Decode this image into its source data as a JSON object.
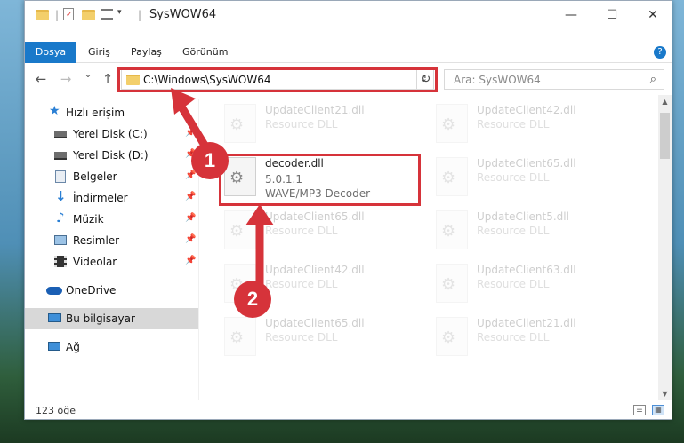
{
  "window": {
    "title": "SysWOW64",
    "controls": {
      "minimize": "—",
      "maximize": "☐",
      "close": "✕"
    }
  },
  "ribbon": {
    "tabs": [
      "Dosya",
      "Giriş",
      "Paylaş",
      "Görünüm"
    ],
    "help": "?"
  },
  "nav": {
    "back": "←",
    "forward": "→",
    "recent": "⌄",
    "up": "↑",
    "address": "C:\\Windows\\SysWOW64",
    "address_chevron": "⌄",
    "refresh": "↻",
    "search_placeholder": "Ara: SysWOW64",
    "search_icon": "⌕"
  },
  "sidebar": {
    "items": [
      {
        "label": "Hızlı erişim",
        "icon": "star-icon",
        "pinned": false
      },
      {
        "label": "Yerel Disk (C:)",
        "icon": "drive-icon",
        "pinned": true
      },
      {
        "label": "Yerel Disk (D:)",
        "icon": "drive-icon",
        "pinned": true
      },
      {
        "label": "Belgeler",
        "icon": "documents-icon",
        "pinned": true
      },
      {
        "label": "İndirmeler",
        "icon": "download-icon",
        "pinned": true
      },
      {
        "label": "Müzik",
        "icon": "music-icon",
        "pinned": true
      },
      {
        "label": "Resimler",
        "icon": "pictures-icon",
        "pinned": true
      },
      {
        "label": "Videolar",
        "icon": "video-icon",
        "pinned": true
      },
      {
        "label": "OneDrive",
        "icon": "cloud-icon",
        "pinned": false
      },
      {
        "label": "Bu bilgisayar",
        "icon": "computer-icon",
        "pinned": false,
        "selected": true
      },
      {
        "label": "Ağ",
        "icon": "network-icon",
        "pinned": false
      }
    ],
    "pin_glyph": "📌"
  },
  "files": [
    {
      "name": "UpdateClient21.dll",
      "type": "Resource DLL"
    },
    {
      "name": "UpdateClient42.dll",
      "type": "Resource DLL"
    },
    {
      "name": "decoder.dll",
      "version": "5.0.1.1",
      "type": "WAVE/MP3 Decoder",
      "highlighted": true
    },
    {
      "name": "UpdateClient65.dll",
      "type": "Resource DLL"
    },
    {
      "name": "UpdateClient65.dll",
      "type": "Resource DLL"
    },
    {
      "name": "UpdateClient5.dll",
      "type": "Resource DLL"
    },
    {
      "name": "UpdateClient42.dll",
      "type": "Resource DLL"
    },
    {
      "name": "UpdateClient63.dll",
      "type": "Resource DLL"
    },
    {
      "name": "UpdateClient65.dll",
      "type": "Resource DLL"
    },
    {
      "name": "UpdateClient21.dll",
      "type": "Resource DLL"
    }
  ],
  "status": {
    "count": "123 öğe"
  },
  "annotations": {
    "step1": "1",
    "step2": "2",
    "color": "#d6333a"
  }
}
